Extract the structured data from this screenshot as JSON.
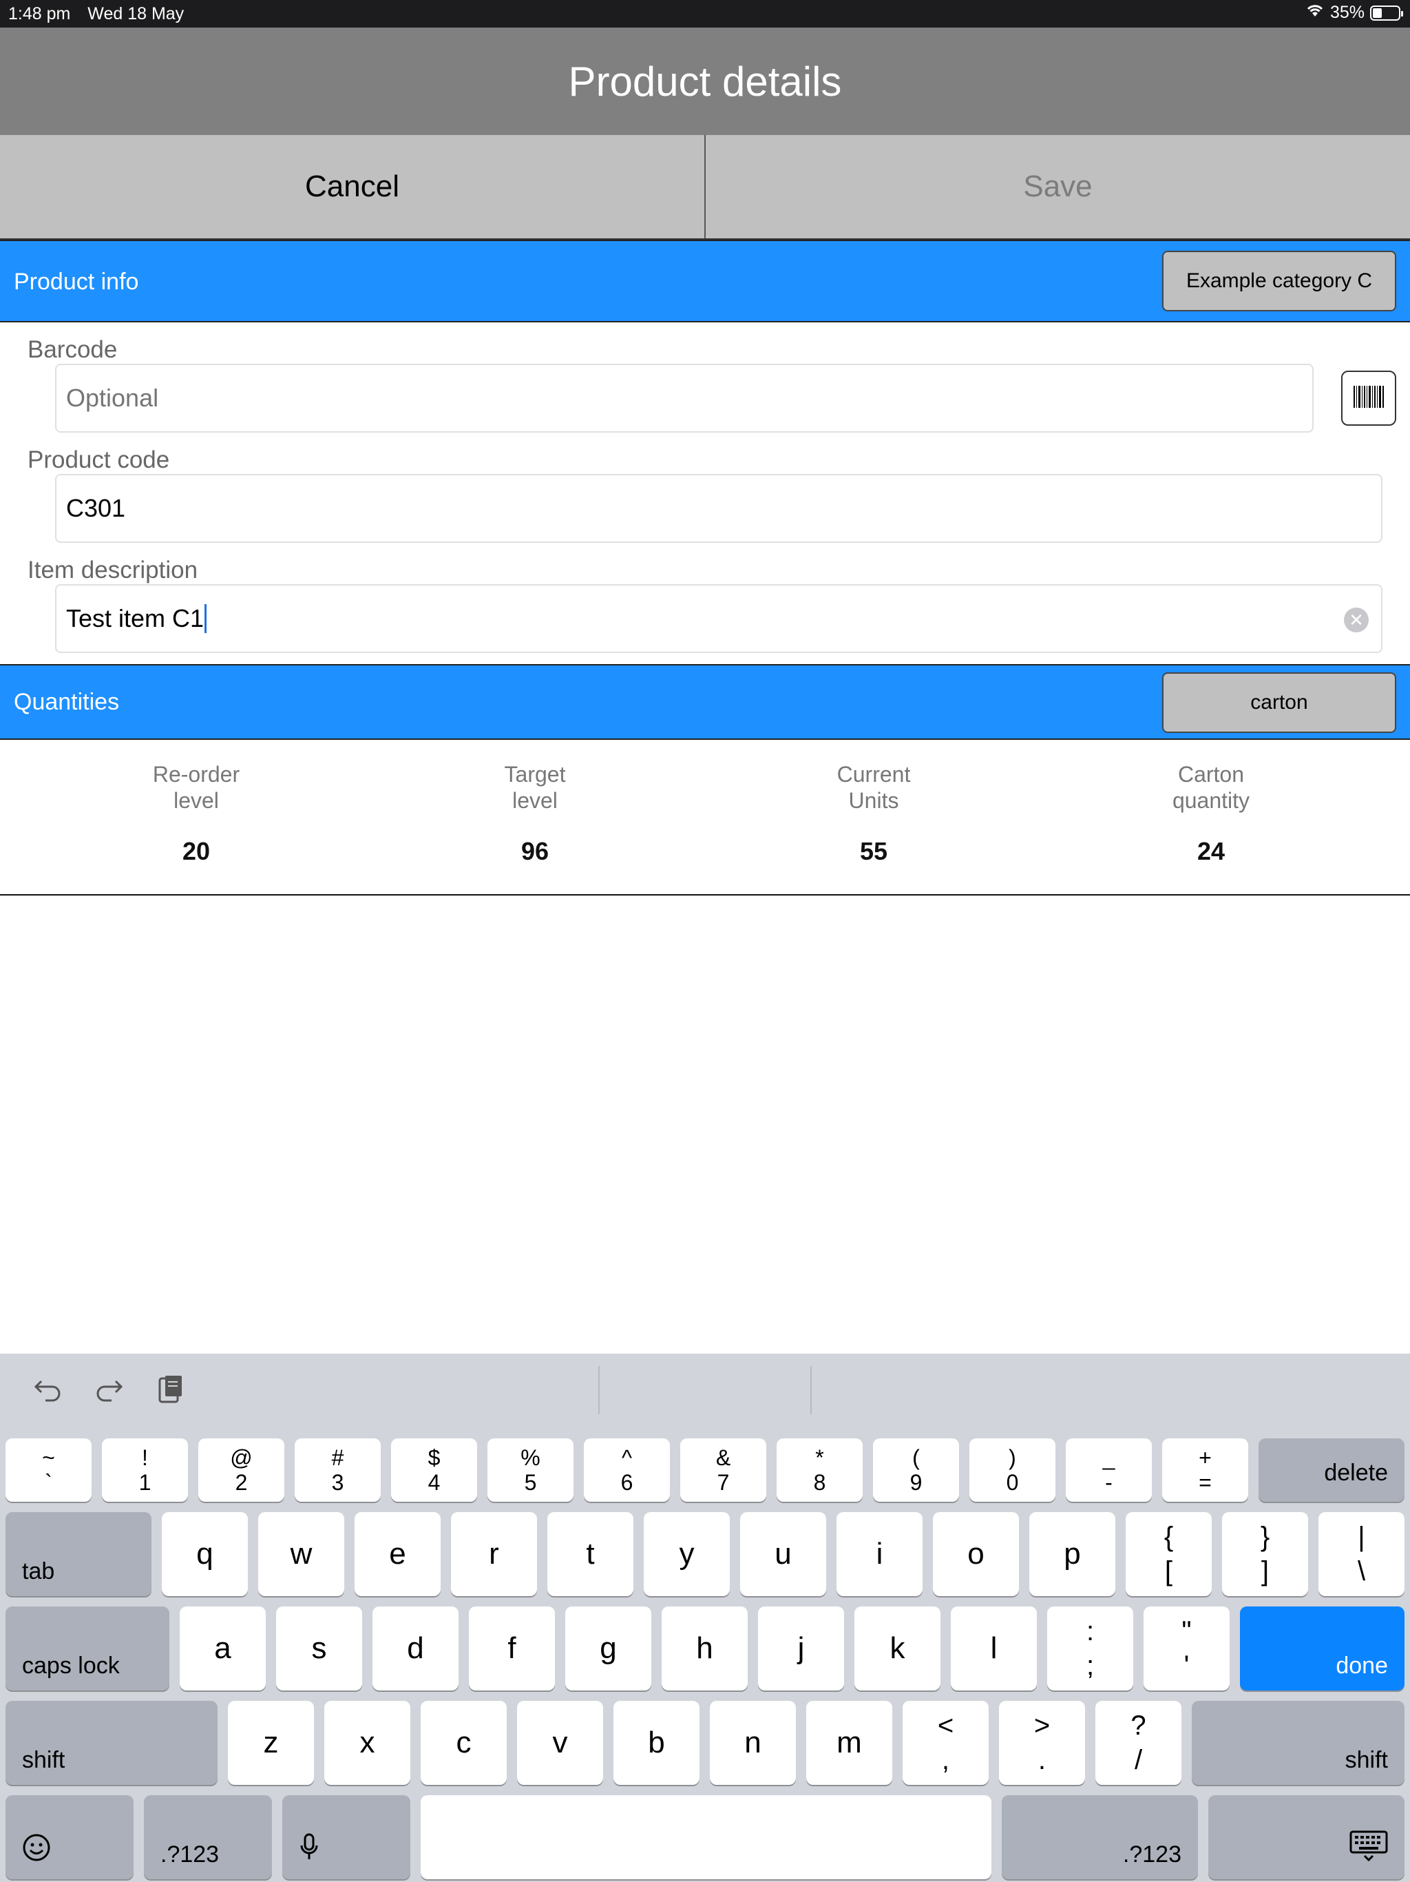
{
  "status_bar": {
    "time": "1:48 pm",
    "date": "Wed 18 May",
    "battery": "35%",
    "battery_level": 0.35
  },
  "title": "Product details",
  "actions": {
    "cancel": "Cancel",
    "save": "Save"
  },
  "product_info": {
    "header": "Product info",
    "category_button": "Example category C",
    "barcode": {
      "label": "Barcode",
      "value": "",
      "placeholder": "Optional"
    },
    "product_code": {
      "label": "Product code",
      "value": "C301"
    },
    "item_description": {
      "label": "Item description",
      "value": "Test item C1"
    }
  },
  "quantities": {
    "header": "Quantities",
    "unit_button": "carton",
    "columns": [
      {
        "label_line1": "Re-order",
        "label_line2": "level",
        "value": "20"
      },
      {
        "label_line1": "Target",
        "label_line2": "level",
        "value": "96"
      },
      {
        "label_line1": "Current",
        "label_line2": "Units",
        "value": "55"
      },
      {
        "label_line1": "Carton",
        "label_line2": "quantity",
        "value": "24"
      }
    ]
  },
  "keyboard": {
    "toolbar": [
      "undo-icon",
      "redo-icon",
      "paste-icon"
    ],
    "row1": [
      {
        "top": "~",
        "bottom": "`"
      },
      {
        "top": "!",
        "bottom": "1"
      },
      {
        "top": "@",
        "bottom": "2"
      },
      {
        "top": "#",
        "bottom": "3"
      },
      {
        "top": "$",
        "bottom": "4"
      },
      {
        "top": "%",
        "bottom": "5"
      },
      {
        "top": "^",
        "bottom": "6"
      },
      {
        "top": "&",
        "bottom": "7"
      },
      {
        "top": "*",
        "bottom": "8"
      },
      {
        "top": "(",
        "bottom": "9"
      },
      {
        "top": ")",
        "bottom": "0"
      },
      {
        "top": "_",
        "bottom": "-"
      },
      {
        "top": "+",
        "bottom": "="
      }
    ],
    "delete": "delete",
    "tab": "tab",
    "row2": [
      "q",
      "w",
      "e",
      "r",
      "t",
      "y",
      "u",
      "i",
      "o",
      "p"
    ],
    "row2_sym": [
      {
        "top": "{",
        "bottom": "["
      },
      {
        "top": "}",
        "bottom": "]"
      },
      {
        "top": "|",
        "bottom": "\\"
      }
    ],
    "caps_lock": "caps lock",
    "row3": [
      "a",
      "s",
      "d",
      "f",
      "g",
      "h",
      "j",
      "k",
      "l"
    ],
    "row3_sym": [
      {
        "top": ":",
        "bottom": ";"
      },
      {
        "top": "\"",
        "bottom": "'"
      }
    ],
    "done": "done",
    "shift": "shift",
    "row4": [
      "z",
      "x",
      "c",
      "v",
      "b",
      "n",
      "m"
    ],
    "row4_sym": [
      {
        "top": "<",
        "bottom": ","
      },
      {
        "top": ">",
        "bottom": "."
      },
      {
        "top": "?",
        "bottom": "/"
      }
    ],
    "numbers": ".?123"
  }
}
